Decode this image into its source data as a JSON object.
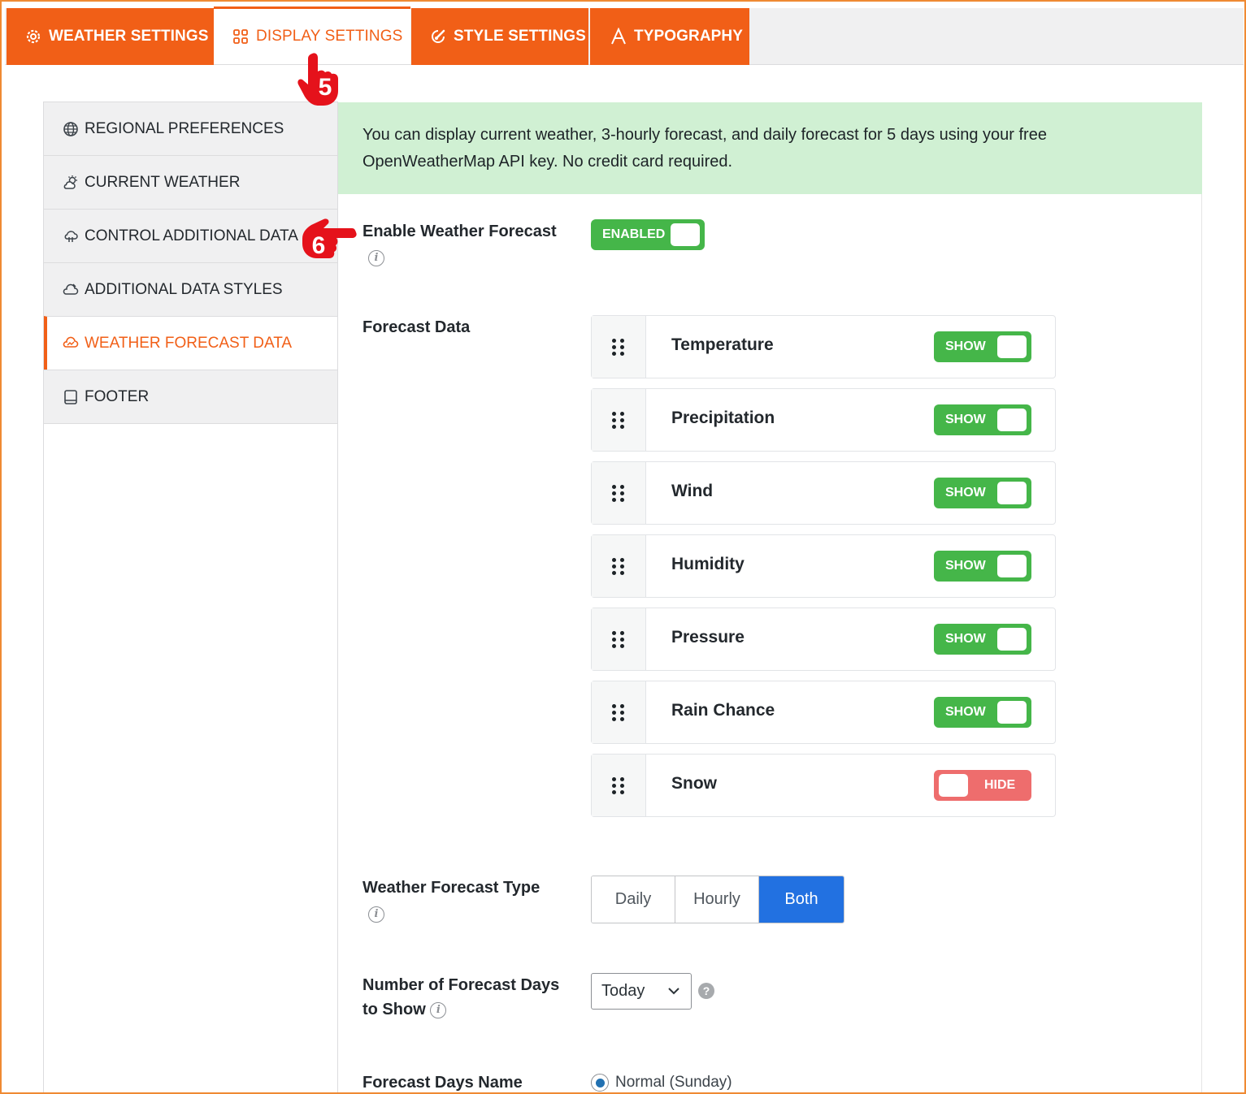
{
  "tabs": [
    {
      "label": "WEATHER SETTINGS",
      "icon": "gear-icon"
    },
    {
      "label": "DISPLAY SETTINGS",
      "icon": "grid-icon",
      "active": true
    },
    {
      "label": "STYLE SETTINGS",
      "icon": "brush-icon"
    },
    {
      "label": "TYPOGRAPHY",
      "icon": "font-icon"
    }
  ],
  "sidebar": {
    "items": [
      {
        "label": "REGIONAL PREFERENCES",
        "icon": "globe-icon"
      },
      {
        "label": "CURRENT WEATHER",
        "icon": "sun-cloud-icon"
      },
      {
        "label": "CONTROL ADDITIONAL DATA",
        "icon": "cloud-data-icon"
      },
      {
        "label": "ADDITIONAL DATA STYLES",
        "icon": "cloud-style-icon"
      },
      {
        "label": "WEATHER FORECAST DATA",
        "icon": "cloud-forecast-icon",
        "active": true
      },
      {
        "label": "FOOTER",
        "icon": "footer-icon"
      }
    ]
  },
  "notice": {
    "line1": "You can display current weather, 3-hourly forecast, and daily forecast for 5 days using your free",
    "line2": "OpenWeatherMap API key. No credit card required."
  },
  "enable_forecast": {
    "label": "Enable Weather Forecast",
    "toggle_label": "ENABLED",
    "enabled": true
  },
  "forecast_data": {
    "label": "Forecast Data",
    "rows": [
      {
        "name": "Temperature",
        "state": "SHOW",
        "on": true
      },
      {
        "name": "Precipitation",
        "state": "SHOW",
        "on": true
      },
      {
        "name": "Wind",
        "state": "SHOW",
        "on": true
      },
      {
        "name": "Humidity",
        "state": "SHOW",
        "on": true
      },
      {
        "name": "Pressure",
        "state": "SHOW",
        "on": true
      },
      {
        "name": "Rain Chance",
        "state": "SHOW",
        "on": true
      },
      {
        "name": "Snow",
        "state": "HIDE",
        "on": false
      }
    ]
  },
  "forecast_type": {
    "label": "Weather Forecast Type",
    "options": [
      "Daily",
      "Hourly",
      "Both"
    ],
    "selected": "Both"
  },
  "forecast_days": {
    "label_line1": "Number of Forecast Days",
    "label_line2": "to Show",
    "value": "Today"
  },
  "days_name": {
    "label": "Forecast Days Name",
    "option": "Normal (Sunday)"
  },
  "callouts": {
    "step5": "5",
    "step6": "6"
  },
  "colors": {
    "accent": "#f15f17",
    "toggle_on": "#45b649",
    "toggle_off": "#ee6d6d",
    "notice_bg": "#d0f0d3",
    "segment_active": "#2271e1"
  }
}
